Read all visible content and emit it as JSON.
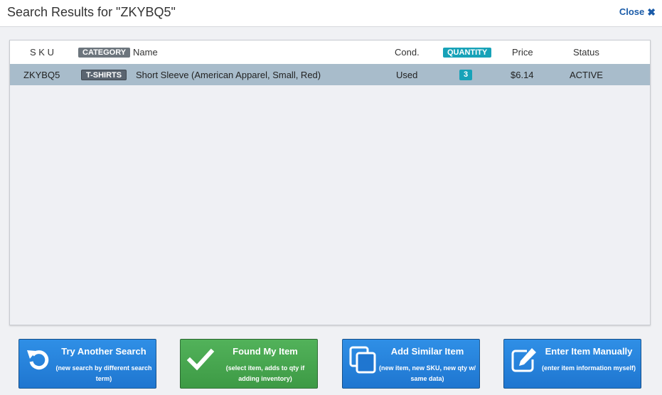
{
  "header": {
    "title": "Search Results for \"ZKYBQ5\"",
    "close_label": "Close"
  },
  "table": {
    "columns": {
      "sku": "S K U",
      "category": "CATEGORY",
      "name": "Name",
      "condition": "Cond.",
      "quantity": "QUANTITY",
      "price": "Price",
      "status": "Status"
    },
    "rows": [
      {
        "sku": "ZKYBQ5",
        "category": "T-SHIRTS",
        "name": "Short Sleeve (American Apparel, Small, Red)",
        "condition": "Used",
        "quantity": "3",
        "price": "$6.14",
        "status": "ACTIVE"
      }
    ]
  },
  "actions": {
    "try_another": {
      "label": "Try Another Search",
      "sub": "(new search by different search term)",
      "icon": "refresh-icon"
    },
    "found_item": {
      "label": "Found My Item",
      "sub": "(select item, adds to qty if adding inventory)",
      "icon": "check-icon"
    },
    "add_similar": {
      "label": "Add Similar Item",
      "sub": "(new item, new SKU, new qty w/ same data)",
      "icon": "copy-icon"
    },
    "enter_manual": {
      "label": "Enter Item Manually",
      "sub": "(enter item information myself)",
      "icon": "edit-icon"
    }
  },
  "colors": {
    "selected_row": "#a8bccb",
    "category_badge": "#6c757d",
    "quantity_badge": "#17a2b8",
    "primary_button": "#1f76d0",
    "success_button": "#3d9a45",
    "link": "#1a5ba8"
  }
}
